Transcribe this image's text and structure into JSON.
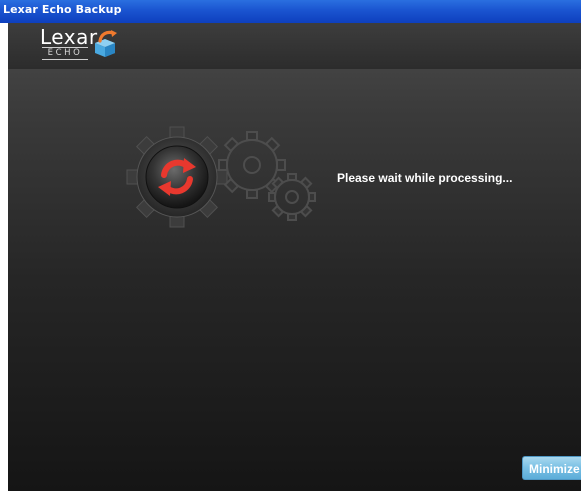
{
  "window": {
    "title": "Lexar Echo Backup"
  },
  "logo": {
    "brand": "Lexar",
    "product": "ECHO"
  },
  "status": {
    "message": "Please wait while processing..."
  },
  "buttons": {
    "minimize_label": "Minimize"
  },
  "icons": {
    "sync": "sync-arrows-icon",
    "gears": "gears-icon",
    "logo_box": "open-box-icon"
  },
  "colors": {
    "titlebar": "#1a54d0",
    "sync_red": "#e8382e",
    "minimize_button": "#78bfe4"
  }
}
